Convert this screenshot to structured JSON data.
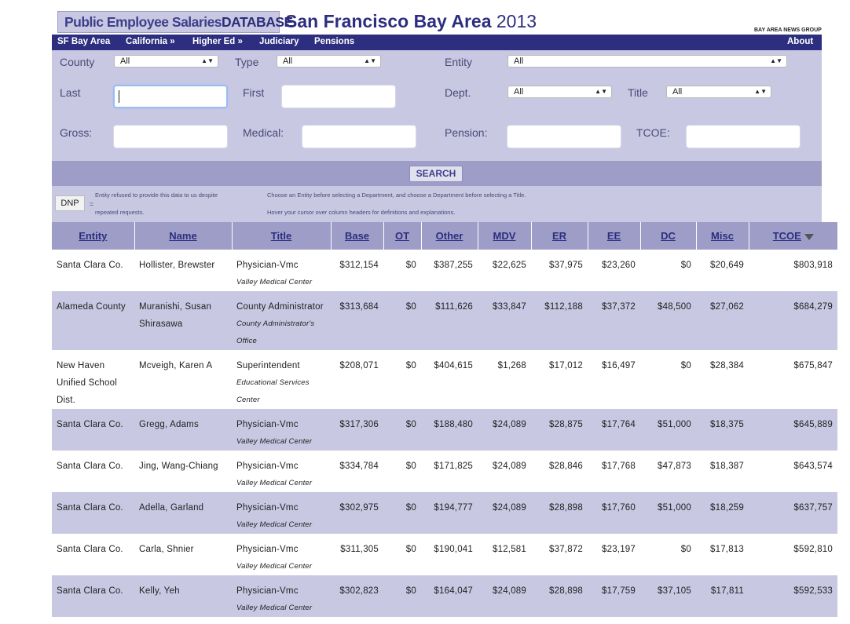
{
  "header": {
    "brand_main": "Public Employee Salaries ",
    "brand_db": "DATABASE",
    "region": "San Francisco Bay Area",
    "year": "2013",
    "publisher": "BAY AREA NEWS GROUP"
  },
  "nav": {
    "items": [
      "SF Bay Area",
      "California »",
      "Higher Ed »",
      "Judiciary",
      "Pensions"
    ],
    "about": "About"
  },
  "filters": {
    "county_label": "County",
    "county_value": "All",
    "type_label": "Type",
    "type_value": "All",
    "entity_label": "Entity",
    "entity_value": "All",
    "last_label": "Last",
    "first_label": "First",
    "dept_label": "Dept.",
    "dept_value": "All",
    "title_label": "Title",
    "title_value": "All",
    "gross_label": "Gross:",
    "medical_label": "Medical:",
    "pension_label": "Pension:",
    "tcoe_label": "TCOE:",
    "search_button": "SEARCH"
  },
  "notes": {
    "dnp": "DNP",
    "equals": "=",
    "dnp_line1": "Entity refused to provide this data to us despite",
    "dnp_line2": "repeated requests.",
    "hint1": "Choose an Entity before selecting a Department, and choose a Department before selecting a Title.",
    "hint2": "Hover your cursor over column headers for definitions and explanations."
  },
  "table": {
    "columns": [
      "Entity",
      "Name",
      "Title",
      "Base",
      "OT",
      "Other",
      "MDV",
      "ER",
      "EE",
      "DC",
      "Misc",
      "TCOE"
    ],
    "sorted_column": "TCOE",
    "rows": [
      {
        "entity": "Santa Clara Co.",
        "name": "Hollister, Brewster",
        "title": "Physician-Vmc",
        "dept": "Valley Medical Center",
        "base": "$312,154",
        "ot": "$0",
        "other": "$387,255",
        "mdv": "$22,625",
        "er": "$37,975",
        "ee": "$23,260",
        "dc": "$0",
        "misc": "$20,649",
        "tcoe": "$803,918"
      },
      {
        "entity": "Alameda County",
        "name": "Muranishi, Susan Shirasawa",
        "title": "County Administrator",
        "dept": "County Administrator's Office",
        "base": "$313,684",
        "ot": "$0",
        "other": "$111,626",
        "mdv": "$33,847",
        "er": "$112,188",
        "ee": "$37,372",
        "dc": "$48,500",
        "misc": "$27,062",
        "tcoe": "$684,279"
      },
      {
        "entity": "New Haven Unified School Dist.",
        "name": "Mcveigh, Karen A",
        "title": "Superintendent",
        "dept": "Educational Services Center",
        "base": "$208,071",
        "ot": "$0",
        "other": "$404,615",
        "mdv": "$1,268",
        "er": "$17,012",
        "ee": "$16,497",
        "dc": "$0",
        "misc": "$28,384",
        "tcoe": "$675,847"
      },
      {
        "entity": "Santa Clara Co.",
        "name": "Gregg, Adams",
        "title": "Physician-Vmc",
        "dept": "Valley Medical Center",
        "base": "$317,306",
        "ot": "$0",
        "other": "$188,480",
        "mdv": "$24,089",
        "er": "$28,875",
        "ee": "$17,764",
        "dc": "$51,000",
        "misc": "$18,375",
        "tcoe": "$645,889"
      },
      {
        "entity": "Santa Clara Co.",
        "name": "Jing, Wang-Chiang",
        "title": "Physician-Vmc",
        "dept": "Valley Medical Center",
        "base": "$334,784",
        "ot": "$0",
        "other": "$171,825",
        "mdv": "$24,089",
        "er": "$28,846",
        "ee": "$17,768",
        "dc": "$47,873",
        "misc": "$18,387",
        "tcoe": "$643,574"
      },
      {
        "entity": "Santa Clara Co.",
        "name": "Adella, Garland",
        "title": "Physician-Vmc",
        "dept": "Valley Medical Center",
        "base": "$302,975",
        "ot": "$0",
        "other": "$194,777",
        "mdv": "$24,089",
        "er": "$28,898",
        "ee": "$17,760",
        "dc": "$51,000",
        "misc": "$18,259",
        "tcoe": "$637,757"
      },
      {
        "entity": "Santa Clara Co.",
        "name": "Carla, Shnier",
        "title": "Physician-Vmc",
        "dept": "Valley Medical Center",
        "base": "$311,305",
        "ot": "$0",
        "other": "$190,041",
        "mdv": "$12,581",
        "er": "$37,872",
        "ee": "$23,197",
        "dc": "$0",
        "misc": "$17,813",
        "tcoe": "$592,810"
      },
      {
        "entity": "Santa Clara Co.",
        "name": "Kelly, Yeh",
        "title": "Physician-Vmc",
        "dept": "Valley Medical Center",
        "base": "$302,823",
        "ot": "$0",
        "other": "$164,047",
        "mdv": "$24,089",
        "er": "$28,898",
        "ee": "$17,759",
        "dc": "$37,105",
        "misc": "$17,811",
        "tcoe": "$592,533"
      }
    ]
  }
}
